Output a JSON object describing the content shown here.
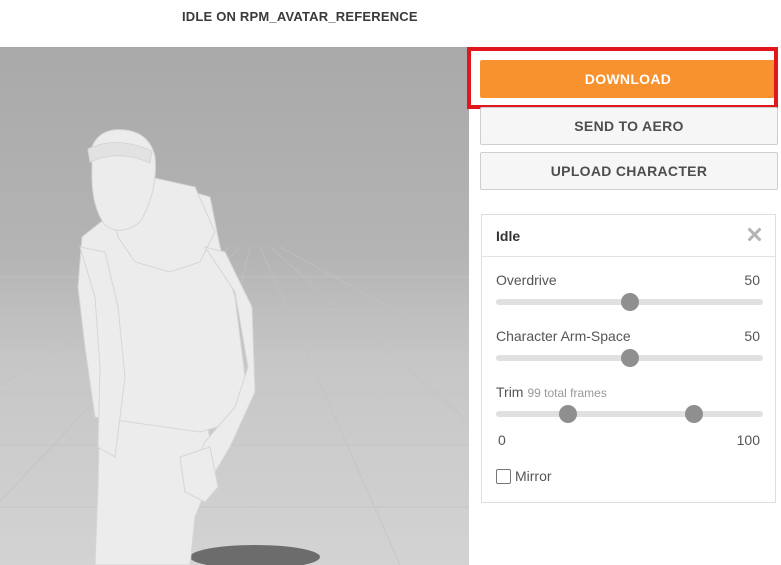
{
  "title": "IDLE ON RPM_AVATAR_REFERENCE",
  "buttons": {
    "download": "DOWNLOAD",
    "send_to_aero": "SEND TO AERO",
    "upload_character": "UPLOAD CHARACTER"
  },
  "panel": {
    "title": "Idle",
    "overdrive": {
      "label": "Overdrive",
      "value": "50",
      "fraction": 0.5
    },
    "arm_space": {
      "label": "Character Arm-Space",
      "value": "50",
      "fraction": 0.5
    },
    "trim": {
      "label": "Trim",
      "hint": "99 total frames",
      "min_label": "0",
      "max_label": "100",
      "start_fraction": 0.27,
      "end_fraction": 0.74
    },
    "mirror": {
      "label": "Mirror",
      "checked": false
    }
  },
  "colors": {
    "accent": "#f7922f",
    "highlight": "#e0171c"
  },
  "icons": {
    "close": "close-icon"
  }
}
